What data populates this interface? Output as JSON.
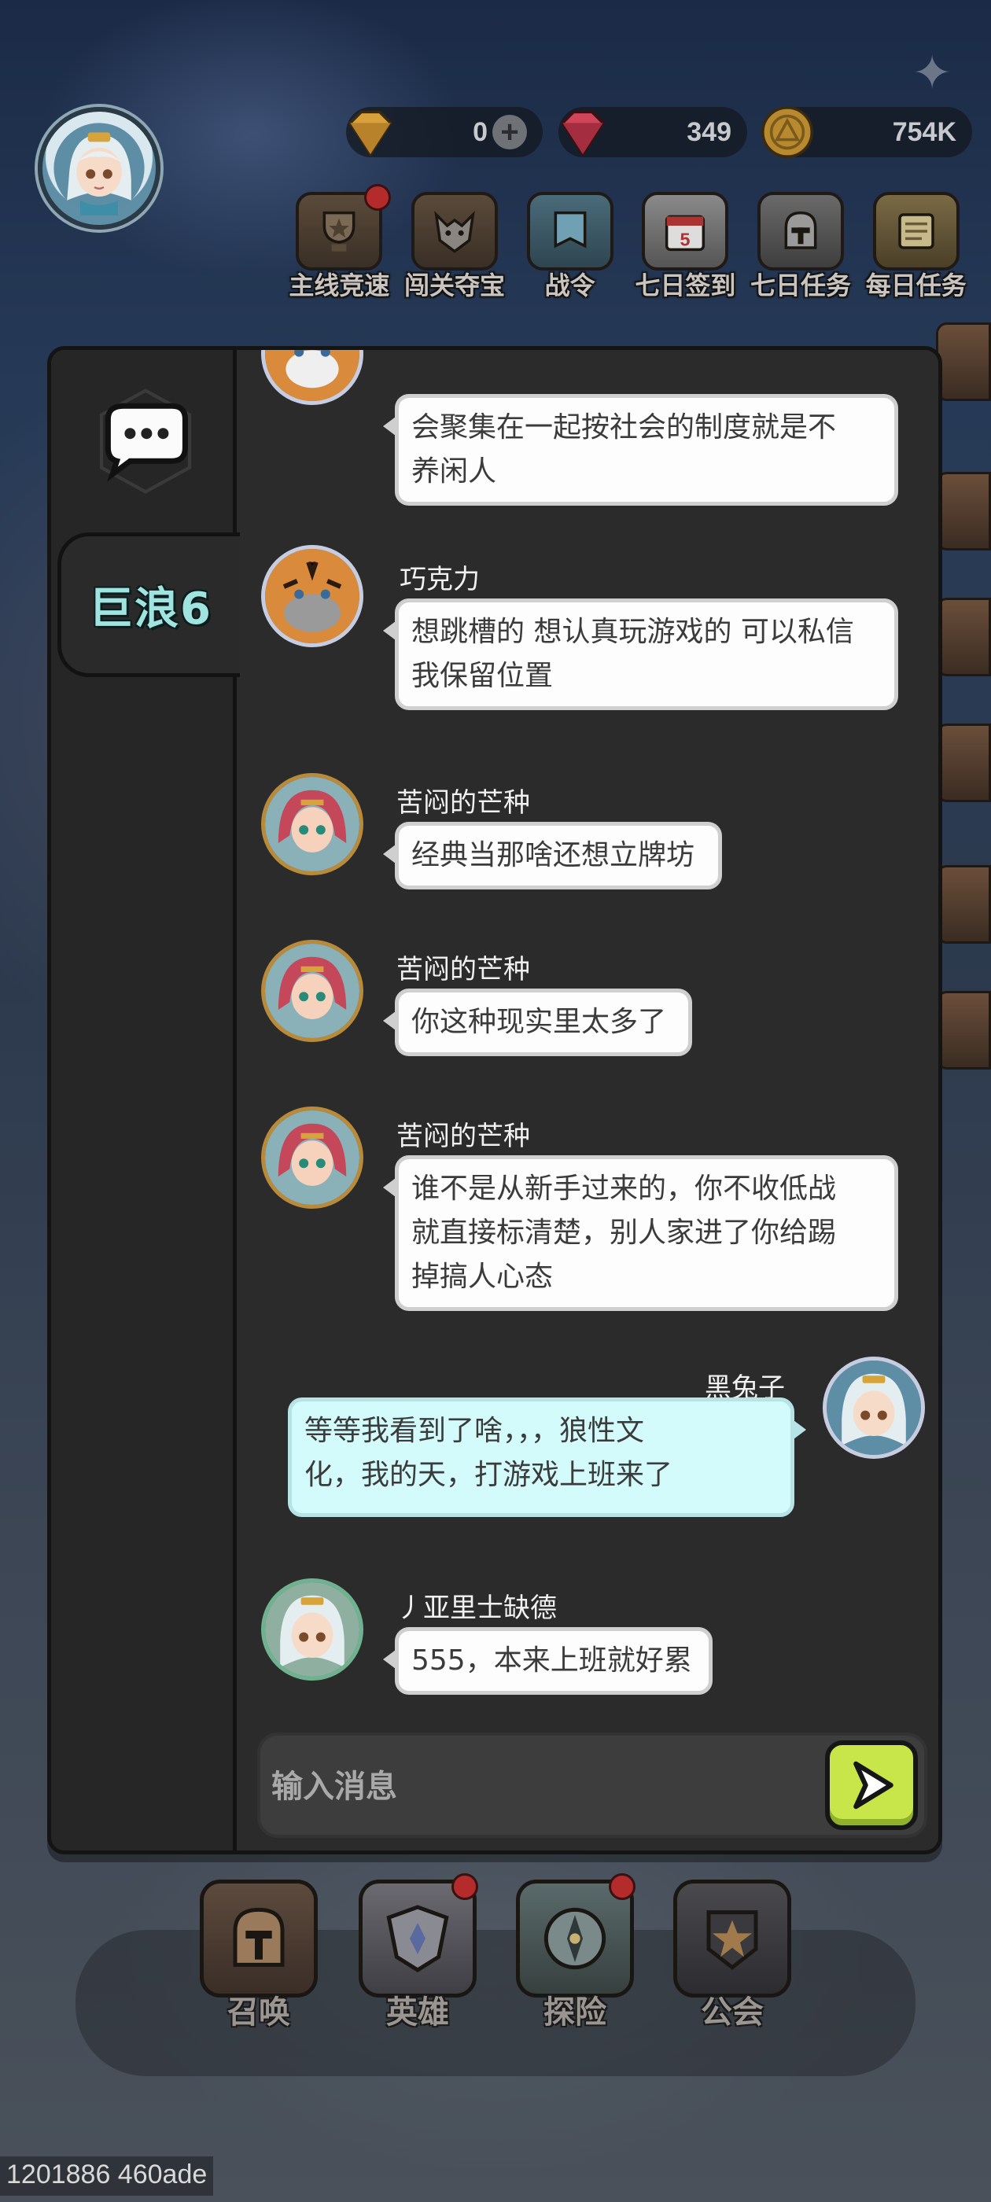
{
  "hud": {
    "currencies": [
      {
        "icon": "gold-gem-icon",
        "value": "0",
        "has_plus": true,
        "color": "#d8a13a"
      },
      {
        "icon": "red-diamond-icon",
        "value": "349",
        "color": "#c03a4a"
      },
      {
        "icon": "coin-icon",
        "value": "754K",
        "color": "#b9892f"
      }
    ],
    "quests": [
      {
        "label": "主线竞速",
        "icon": "trophy-icon",
        "badge": true
      },
      {
        "label": "闯关夺宝",
        "icon": "wolf-icon",
        "badge": false
      },
      {
        "label": "战令",
        "icon": "banner-icon",
        "badge": false
      },
      {
        "label": "七日签到",
        "icon": "calendar-icon",
        "badge": false
      },
      {
        "label": "七日任务",
        "icon": "helmet-icon",
        "badge": false
      },
      {
        "label": "每日任务",
        "icon": "scroll-icon",
        "badge": false
      }
    ]
  },
  "chat": {
    "channel_tab": "巨浪6",
    "input_placeholder": "输入消息",
    "messages": [
      {
        "sender": "",
        "text_lines": [
          "会聚集在一起按社会的制度就是不",
          "养闲人"
        ],
        "avatar": "tiger-avatar",
        "self": false
      },
      {
        "sender": "巧克力",
        "text_lines": [
          "想跳槽的 想认真玩游戏的 可以私信",
          "我保留位置"
        ],
        "avatar": "tiger-avatar",
        "self": false
      },
      {
        "sender": "苦闷的芒种",
        "text_lines": [
          "经典当那啥还想立牌坊"
        ],
        "avatar": "elf-girl-avatar",
        "self": false
      },
      {
        "sender": "苦闷的芒种",
        "text_lines": [
          "你这种现实里太多了"
        ],
        "avatar": "elf-girl-avatar",
        "self": false
      },
      {
        "sender": "苦闷的芒种",
        "text_lines": [
          "谁不是从新手过来的，你不收低战",
          "就直接标清楚，别人家进了你给踢",
          "掉搞人心态"
        ],
        "avatar": "elf-girl-avatar",
        "self": false
      },
      {
        "sender": "黑兔子",
        "text_lines": [
          "等等我看到了啥，，，狼性文",
          "化，我的天，打游戏上班来了"
        ],
        "avatar": "white-hair-avatar",
        "self": true
      },
      {
        "sender": "丿亚里士缺德",
        "text_lines": [
          "555，本来上班就好累"
        ],
        "avatar": "white-hair-avatar",
        "self": false
      }
    ]
  },
  "bottom_nav": [
    {
      "label": "召唤",
      "icon": "summon-helmet-icon",
      "badge": false
    },
    {
      "label": "英雄",
      "icon": "hero-crest-icon",
      "badge": true
    },
    {
      "label": "探险",
      "icon": "compass-icon",
      "badge": true
    },
    {
      "label": "公会",
      "icon": "guild-star-icon",
      "badge": false
    }
  ],
  "version": "1201886 460ade"
}
